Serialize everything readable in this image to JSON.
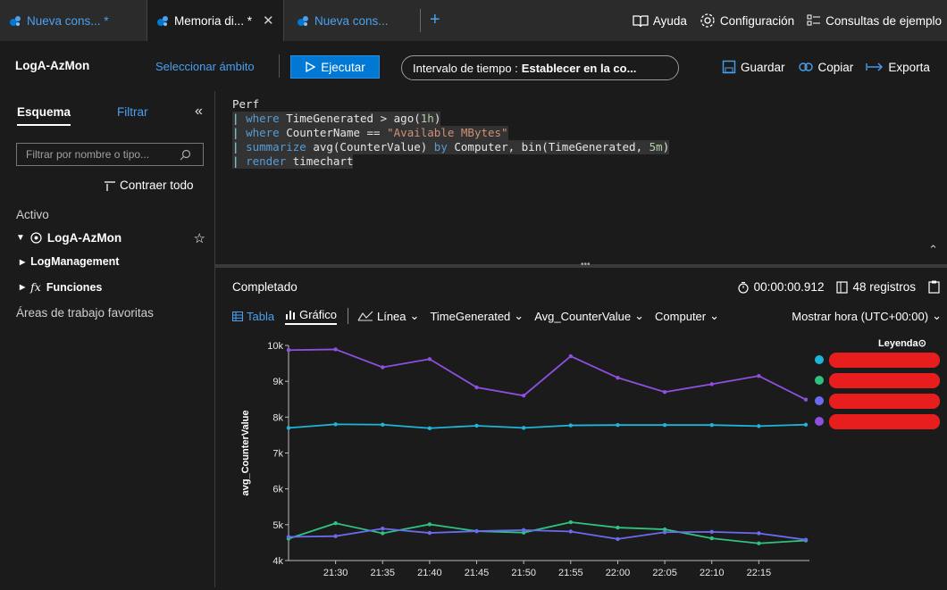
{
  "tabs": [
    {
      "label": "Nueva cons... *",
      "active": false
    },
    {
      "label": "Memoria di... *",
      "active": true
    },
    {
      "label": "Nueva cons...",
      "active": false
    }
  ],
  "add_tab": "+",
  "top_links": {
    "help": "Ayuda",
    "settings": "Configuración",
    "samples": "Consultas de ejemplo"
  },
  "toolbar": {
    "workspace": "LogA-AzMon",
    "scope": "Seleccionar ámbito",
    "run": "Ejecutar",
    "time_label": "Intervalo de tiempo :",
    "time_value": "Establecer en la co...",
    "save": "Guardar",
    "copy": "Copiar",
    "export": "Exporta"
  },
  "sidebar": {
    "tab_schema": "Esquema",
    "tab_filter": "Filtrar",
    "search_placeholder": "Filtrar por nombre o tipo...",
    "collapse_all": "Contraer todo",
    "active": "Activo",
    "workspace": "LogA-AzMon",
    "nodes": [
      "LogManagement",
      "Funciones"
    ],
    "favorites": "Áreas de trabajo favoritas"
  },
  "editor": {
    "lines": [
      "Perf",
      "| where TimeGenerated > ago(1h)",
      "| where CounterName == \"Available MBytes\"",
      "| summarize avg(CounterValue) by Computer, bin(TimeGenerated, 5m)",
      "| render timechart"
    ]
  },
  "results": {
    "status": "Completado",
    "duration": "00:00:00.912",
    "records": "48 registros",
    "tab_table": "Tabla",
    "tab_chart": "Gráfico",
    "chart_type": "Línea",
    "x_field": "TimeGenerated",
    "y_field": "Avg_CounterValue",
    "split_field": "Computer",
    "timezone": "Mostrar hora (UTC+00:00)"
  },
  "legend_title": "Leyenda",
  "colors": {
    "accent": "#0078d4",
    "link": "#4ba0f0",
    "redaction": "#e81e1e"
  },
  "chart_data": {
    "type": "line",
    "ylabel": "avg_CounterValue",
    "x": [
      "21:25",
      "21:30",
      "21:35",
      "21:40",
      "21:45",
      "21:50",
      "21:55",
      "22:00",
      "22:05",
      "22:10",
      "22:15",
      "22:20"
    ],
    "x_tick_labels": [
      "21:30",
      "21:35",
      "21:40",
      "21:45",
      "21:50",
      "21:55",
      "22:00",
      "22:05",
      "22:10",
      "22:15"
    ],
    "y_ticks": [
      "4k",
      "5k",
      "6k",
      "7k",
      "8k",
      "9k",
      "10k"
    ],
    "ylim": [
      4000,
      10000
    ],
    "series": [
      {
        "color": "#1fb4d8",
        "values": [
          7700,
          7800,
          7790,
          7690,
          7760,
          7700,
          7770,
          7780,
          7780,
          7780,
          7750,
          7790
        ]
      },
      {
        "color": "#2ec27e",
        "values": [
          4610,
          5040,
          4760,
          5010,
          4820,
          4780,
          5070,
          4920,
          4870,
          4620,
          4480,
          4560
        ]
      },
      {
        "color": "#6b6bef",
        "values": [
          4660,
          4680,
          4890,
          4770,
          4820,
          4850,
          4810,
          4600,
          4790,
          4800,
          4760,
          4580
        ]
      },
      {
        "color": "#8f4fe0",
        "values": [
          9870,
          9890,
          9390,
          9620,
          8830,
          8600,
          9700,
          9100,
          8700,
          8920,
          9150,
          8490
        ]
      }
    ]
  }
}
